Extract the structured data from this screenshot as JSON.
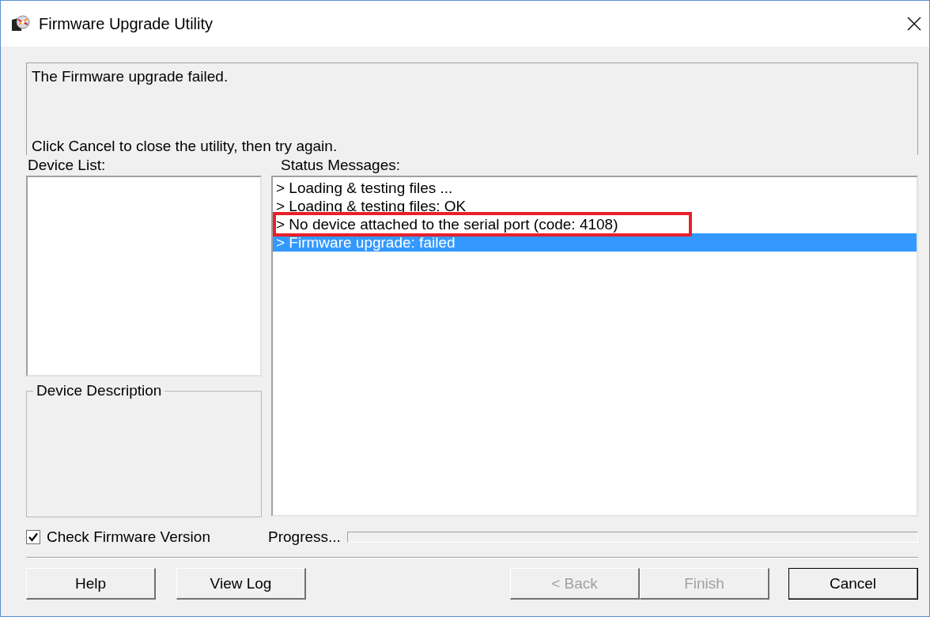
{
  "window": {
    "title": "Firmware Upgrade Utility"
  },
  "info_panel": {
    "heading": "The Firmware upgrade failed.",
    "instruction": "Click Cancel to close the utility, then try again."
  },
  "device_list": {
    "label": "Device List:"
  },
  "device_description": {
    "label": "Device Description"
  },
  "status_messages": {
    "label": "Status Messages:",
    "items": [
      {
        "marker": ">",
        "text": "Loading & testing files ...",
        "selected": false,
        "highlighted": false
      },
      {
        "marker": ">",
        "text": "Loading & testing files: OK",
        "selected": false,
        "highlighted": false
      },
      {
        "marker": ">",
        "text": "No device attached to the serial port (code: 4108)",
        "selected": false,
        "highlighted": true
      },
      {
        "marker": ">",
        "text": "Firmware upgrade: failed",
        "selected": true,
        "highlighted": false
      }
    ]
  },
  "check_firmware_version": {
    "label": "Check Firmware Version",
    "checked": true
  },
  "progress": {
    "label": "Progress...",
    "level": 0
  },
  "buttons": [
    {
      "label": "Help",
      "disabled": false,
      "default": false
    },
    {
      "label": "View Log",
      "disabled": false,
      "default": false
    },
    {
      "label": "< Back",
      "disabled": true,
      "default": false
    },
    {
      "label": "Finish",
      "disabled": true,
      "default": false
    },
    {
      "label": "Cancel",
      "disabled": false,
      "default": true
    }
  ]
}
